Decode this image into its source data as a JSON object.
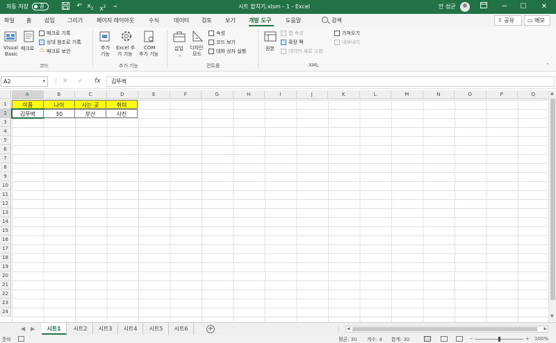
{
  "titlebar": {
    "autosave_label": "자동 저장",
    "autosave_state": "끔",
    "doc_title": "시트 합치기.xlsm  -  1  -  Excel",
    "user_name": "안 성균",
    "qa_icons": [
      "save-icon",
      "subscript-icon",
      "superscript-icon",
      "customize-icon"
    ]
  },
  "menu": {
    "tabs": [
      "파일",
      "홈",
      "삽입",
      "그리기",
      "페이지 레이아웃",
      "수식",
      "데이터",
      "검토",
      "보기",
      "개발 도구",
      "도움말"
    ],
    "active_tab": "개발 도구",
    "search": "검색",
    "share": "공유",
    "memo": "메모"
  },
  "ribbon": {
    "code": {
      "label": "코드",
      "visual_basic": [
        "Visual",
        "Basic"
      ],
      "macro": "매크로",
      "record_macro": "매크로 기록",
      "relative_ref": "상대 참조로 기록",
      "macro_security": "매크로 보안"
    },
    "addins": {
      "label": "추가 기능",
      "addins_btn": [
        "추가",
        "기능"
      ],
      "excel_addins": [
        "Excel 추",
        "가 기능"
      ],
      "com_addins": [
        "COM",
        "추가 기능"
      ]
    },
    "controls": {
      "label": "컨트롤",
      "insert": "삽입",
      "design_mode": [
        "디자인",
        "모드"
      ],
      "properties": "속성",
      "view_code": "코드 보기",
      "run_dialog": "대화 상자 실행"
    },
    "xml": {
      "label": "XML",
      "source": "원본",
      "map_properties": "맵 속성",
      "expansion_packs": "확장 팩",
      "refresh_data": "데이터 새로 고침",
      "import": "가져오기",
      "export": "내보내기"
    }
  },
  "formula_bar": {
    "name_box": "A2",
    "cancel": "✕",
    "enter": "✓",
    "fx": "fx",
    "content": "김뚜벅"
  },
  "grid": {
    "columns": [
      "A",
      "B",
      "C",
      "D",
      "E",
      "F",
      "G",
      "H",
      "I",
      "J",
      "K",
      "L",
      "M",
      "N",
      "O",
      "P",
      "Q"
    ],
    "rows": [
      "1",
      "2",
      "3",
      "4",
      "5",
      "6",
      "7",
      "8",
      "9",
      "10",
      "11",
      "12",
      "13",
      "14",
      "15",
      "16",
      "17",
      "18",
      "19",
      "20",
      "21",
      "22",
      "23",
      "24"
    ],
    "header_row": [
      "이름",
      "나이",
      "사는 곳",
      "취미"
    ],
    "data_row": [
      "김뚜벅",
      "30",
      "부산",
      "사진"
    ],
    "header_fill": "#ffff00"
  },
  "sheets": {
    "tabs": [
      "시트1",
      "시트2",
      "시트3",
      "시트4",
      "시트5",
      "시트6"
    ],
    "active": "시트1"
  },
  "status": {
    "ready": "준비",
    "average": "평균: 30",
    "count": "개수: 4",
    "sum": "합계: 30",
    "zoom": "100%"
  },
  "colors": {
    "excel_green": "#217346",
    "header_yellow": "#ffff00"
  }
}
